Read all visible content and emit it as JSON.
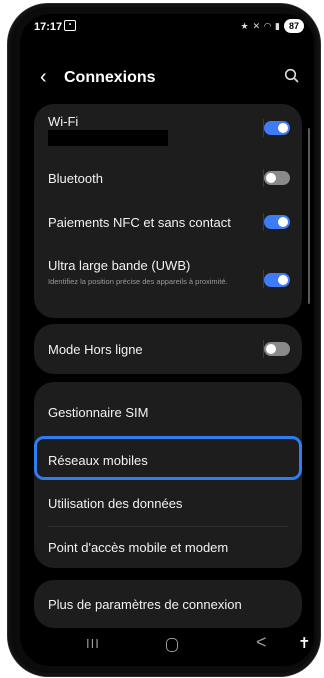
{
  "status_bar": {
    "time": "17:17",
    "icons": [
      "star-icon",
      "mute-icon",
      "wifi-icon",
      "signal-icon"
    ],
    "battery": "87"
  },
  "header": {
    "back_icon": "chevron-left-icon",
    "title": "Connexions",
    "search_icon": "search-icon"
  },
  "sections": [
    {
      "items": [
        {
          "label": "Wi-Fi",
          "toggle": "on",
          "note": "network name redacted"
        },
        {
          "label": "Bluetooth",
          "toggle": "off"
        },
        {
          "label": "Paiements NFC et sans contact",
          "toggle": "on"
        },
        {
          "label": "Ultra large bande (UWB)",
          "sub": "Identifiez la position précise des appareils à proximité.",
          "toggle": "on"
        }
      ]
    },
    {
      "items": [
        {
          "label": "Mode Hors ligne",
          "toggle": "off"
        }
      ]
    },
    {
      "items": [
        {
          "label": "Gestionnaire SIM"
        },
        {
          "label": "Réseaux mobiles",
          "highlighted": true
        },
        {
          "label": "Utilisation des données"
        },
        {
          "label": "Point d'accès mobile et modem"
        }
      ]
    },
    {
      "items": [
        {
          "label": "Plus de paramètres de connexion"
        }
      ]
    }
  ],
  "nav_bar": {
    "recent": "III",
    "home_icon": "home-icon",
    "back": "<",
    "accessibility_icon": "accessibility-icon"
  },
  "colors": {
    "accent": "#3d7bf7",
    "highlight_border": "#2f7df2",
    "card_bg": "#1d1d1d",
    "screen_bg": "#000000"
  }
}
